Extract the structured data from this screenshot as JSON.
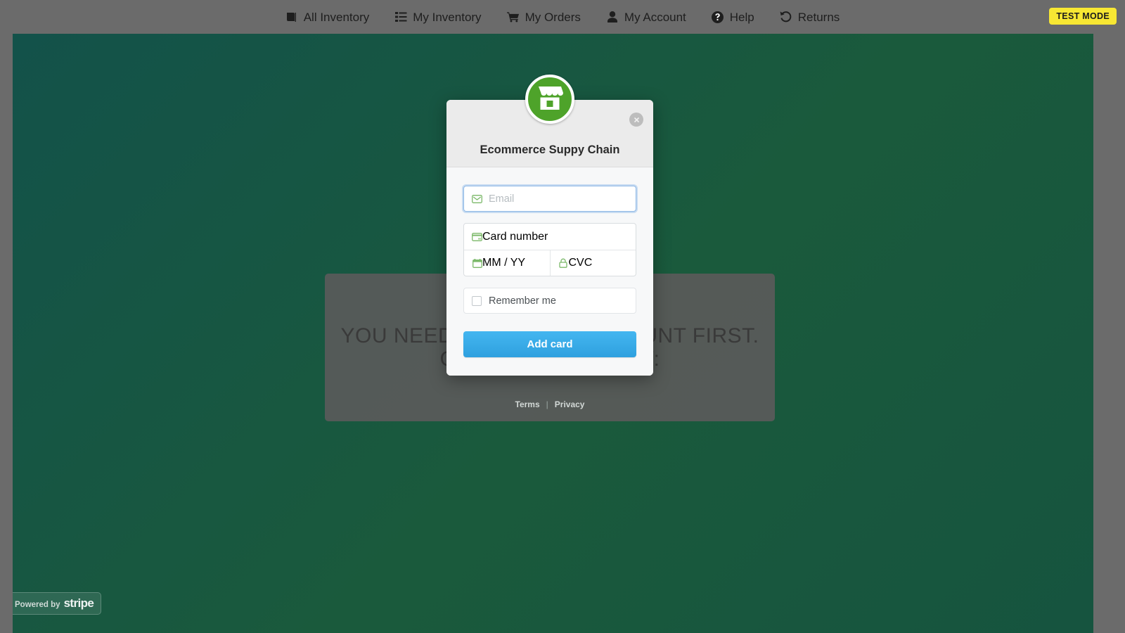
{
  "navbar": {
    "items": [
      {
        "label": "All Inventory",
        "icon": "book-icon"
      },
      {
        "label": "My Inventory",
        "icon": "list-icon"
      },
      {
        "label": "My Orders",
        "icon": "shopping-cart-icon"
      },
      {
        "label": "My Account",
        "icon": "user-icon"
      },
      {
        "label": "Help",
        "icon": "question-circle-icon"
      },
      {
        "label": "Returns",
        "icon": "undo-arrow-icon"
      }
    ],
    "test_mode_label": "TEST MODE"
  },
  "background": {
    "message_line1": "YOU NEED TO ADD AN ACCOUNT FIRST.",
    "message_line2": "CLICK HERE BELOW:",
    "page_color": "#16543f"
  },
  "stripe_badge": {
    "powered_by": "Powered by",
    "brand": "stripe"
  },
  "modal": {
    "merchant_name": "Ecommerce Suppy Chain",
    "logo_icon": "storefront-icon",
    "logo_color": "#4ea32a",
    "close_icon": "close-circle-icon",
    "fields": {
      "email": {
        "placeholder": "Email",
        "value": "",
        "icon": "envelope-icon"
      },
      "card_number": {
        "placeholder": "Card number",
        "value": "",
        "icon": "credit-card-icon"
      },
      "expiry": {
        "placeholder": "MM / YY",
        "value": "",
        "icon": "calendar-icon"
      },
      "cvc": {
        "placeholder": "CVC",
        "value": "",
        "icon": "lock-icon"
      }
    },
    "remember_me": {
      "label": "Remember me",
      "checked": false
    },
    "submit_label": "Add card",
    "submit_color": "#2ea0df",
    "footer": {
      "terms": "Terms",
      "separator": "|",
      "privacy": "Privacy"
    }
  }
}
